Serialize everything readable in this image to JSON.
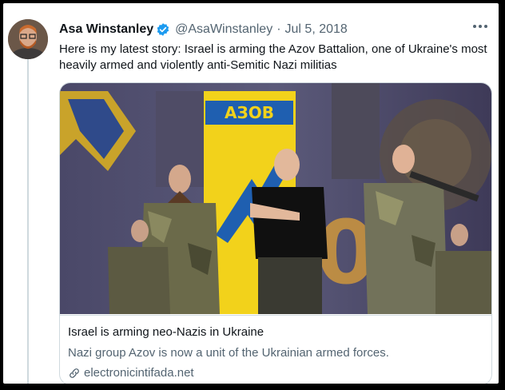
{
  "tweet": {
    "author_name": "Asa Winstanley",
    "handle": "@AsaWinstanley",
    "separator": "·",
    "date": "Jul 5, 2018",
    "text": "Here is my latest story: Israel is arming the Azov Battalion, one of Ukraine's most heavily armed and violently anti-Semitic Nazi militias",
    "verified": true
  },
  "card": {
    "banner_text": "АЗОВ",
    "title": "Israel is arming neo-Nazis in Ukraine",
    "description": "Nazi group Azov is now a unit of the Ukrainian armed forces.",
    "domain": "electronicintifada.net"
  },
  "colors": {
    "verified_blue": "#1d9bf0",
    "banner_yellow": "#f2d21b",
    "banner_blue": "#1f5fb0"
  },
  "icons": {
    "verified": "verified-badge-icon",
    "more": "more-options-icon",
    "link": "link-icon"
  }
}
